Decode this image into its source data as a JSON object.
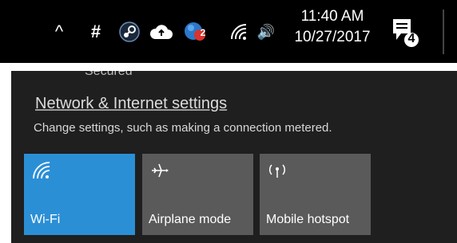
{
  "taskbar": {
    "icons": [
      "chevron-up-icon",
      "hash-icon",
      "steam-icon",
      "cloud-upload-icon",
      "shield-badge-icon",
      "wifi-icon",
      "speaker-icon"
    ],
    "chevron_glyph": "^",
    "hash_glyph": "#",
    "shield_badge": "2",
    "speaker_glyph": "🔊",
    "time": "11:40 AM",
    "date": "10/27/2017",
    "notification_count": "4"
  },
  "flyout": {
    "partial_text": "Secured",
    "settings_link": "Network & Internet settings",
    "settings_desc": "Change settings, such as making a connection metered.",
    "tiles": [
      {
        "label": "Wi-Fi",
        "icon": "wifi-icon",
        "active": true,
        "color": "#2b8fd6"
      },
      {
        "label": "Airplane mode",
        "icon": "airplane-icon",
        "active": false,
        "color": "#5a5a5a"
      },
      {
        "label": "Mobile hotspot",
        "icon": "hotspot-icon",
        "active": false,
        "color": "#5a5a5a"
      }
    ]
  },
  "colors": {
    "taskbar_bg": "#000000",
    "flyout_bg": "#1f1f1f",
    "accent": "#2b8fd6",
    "shield_badge_bg": "#d9342b"
  }
}
